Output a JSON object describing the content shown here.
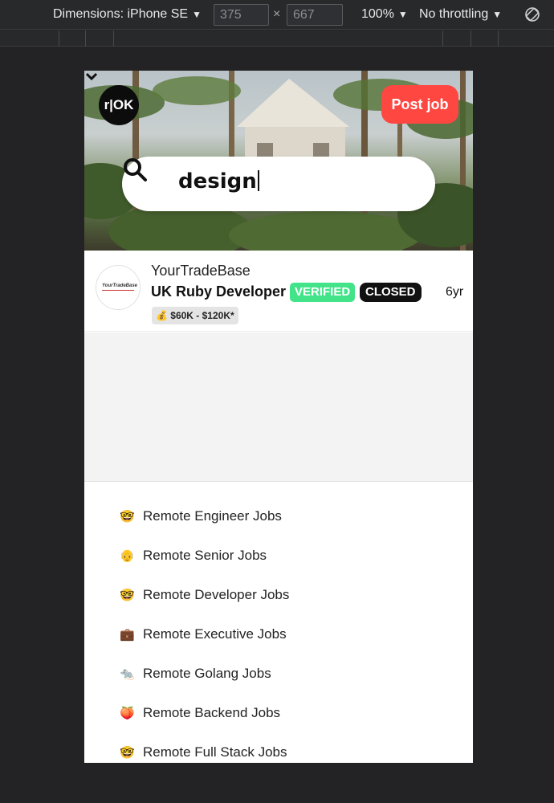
{
  "devtools": {
    "dimensions": "Dimensions: iPhone SE",
    "width": "375",
    "x": "×",
    "height": "667",
    "zoom": "100%",
    "throttling": "No throttling"
  },
  "header": {
    "logo": "r|OK",
    "post_job": "Post job"
  },
  "search": {
    "value": "design"
  },
  "job": {
    "company_logo_text": "YourTradeBase",
    "company": "YourTradeBase",
    "title": "UK Ruby Developer",
    "verified": "VERIFIED",
    "closed": "CLOSED",
    "age": "6yr",
    "salary": "💰 $60K - $120K*"
  },
  "links": [
    {
      "emoji": "🤓",
      "label": "Remote Engineer Jobs"
    },
    {
      "emoji": "👴",
      "label": "Remote Senior Jobs"
    },
    {
      "emoji": "🤓",
      "label": "Remote Developer Jobs"
    },
    {
      "emoji": "💼",
      "label": "Remote Executive Jobs"
    },
    {
      "emoji": "🐀",
      "label": "Remote Golang Jobs"
    },
    {
      "emoji": "🍑",
      "label": "Remote Backend Jobs"
    },
    {
      "emoji": "🤓",
      "label": "Remote Full Stack Jobs"
    }
  ]
}
